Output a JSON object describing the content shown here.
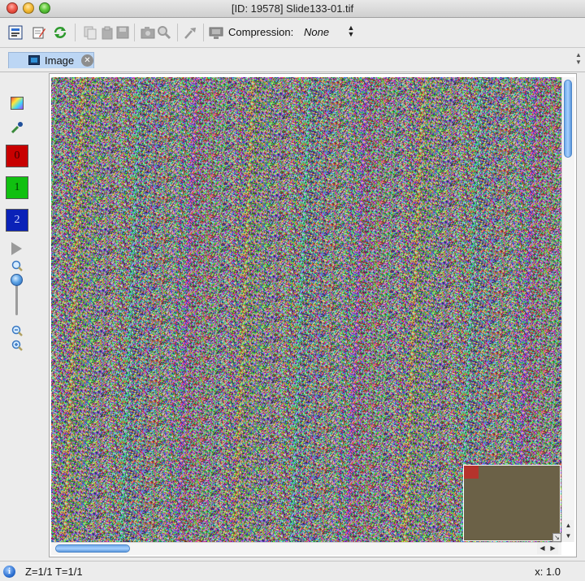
{
  "window": {
    "title": "[ID: 19578] Slide133-01.tif"
  },
  "toolbar": {
    "icons_left": [
      "image-info-icon",
      "edit-annotate-icon",
      "refresh-icon"
    ],
    "icons_disabled_group1": [
      "copy-icon",
      "paste-icon",
      "save-icon"
    ],
    "icons_disabled_group2": [
      "camera-icon",
      "magnify-icon"
    ],
    "icons_disabled_group3": [
      "pick-tool-icon"
    ],
    "compression_label": "Compression:",
    "compression_value": "None"
  },
  "tabs": [
    {
      "label": "Image",
      "icon": "image-tab-icon",
      "active": true
    }
  ],
  "palette": {
    "channels": [
      {
        "label": "0",
        "color": "#c80000"
      },
      {
        "label": "1",
        "color": "#10c010"
      },
      {
        "label": "2",
        "color": "#0a22b8"
      }
    ]
  },
  "status": {
    "zt": "Z=1/1 T=1/1",
    "x": "x: 1.0"
  },
  "colors": {
    "tab_active": "#bcd6f4",
    "scroll_thumb": "#6ea8e8",
    "thumbnail_viewport": "#b5332c"
  }
}
